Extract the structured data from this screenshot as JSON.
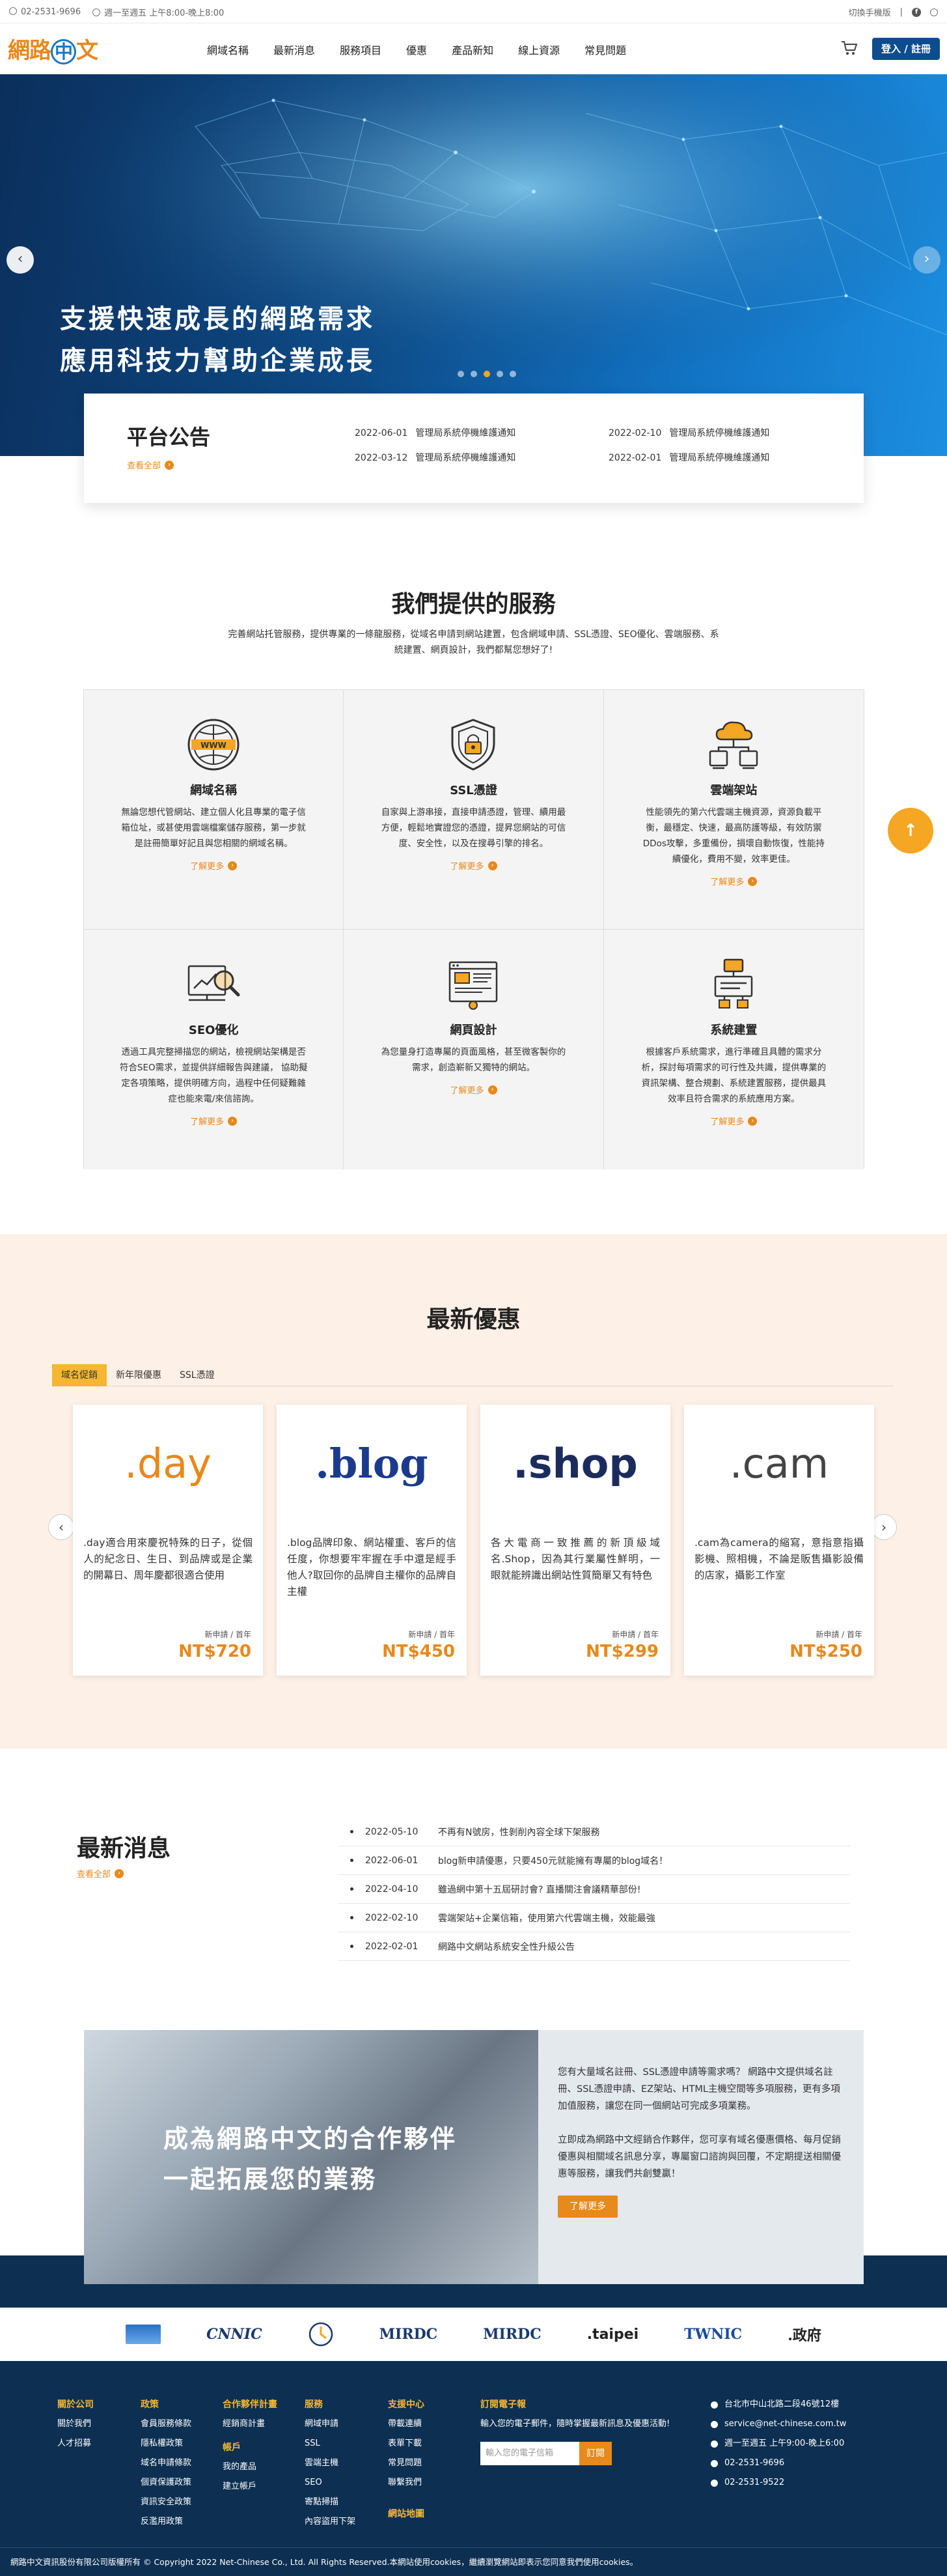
{
  "topbar": {
    "phone": "02-2531-9696",
    "hours": "週一至週五 上午8:00-晚上8:00",
    "mobile": "切換手機版"
  },
  "nav": {
    "logo_a": "網路",
    "logo_b": "中",
    "logo_c": "文",
    "items": [
      "網域名稱",
      "最新消息",
      "服務項目",
      "優惠",
      "產品新知",
      "線上資源",
      "常見問題"
    ],
    "login": "登入 / 註冊"
  },
  "hero": {
    "line1": "支援快速成長的網路需求",
    "line2": "應用科技力幫助企業成長"
  },
  "announce": {
    "title": "平台公告",
    "more": "查看全部",
    "items": [
      {
        "date": "2022-06-01",
        "text": "管理局系統停機維護通知"
      },
      {
        "date": "2022-02-10",
        "text": "管理局系統停機維護通知"
      },
      {
        "date": "2022-03-12",
        "text": "管理局系統停機維護通知"
      },
      {
        "date": "2022-02-01",
        "text": "管理局系統停機維護通知"
      }
    ]
  },
  "services": {
    "title": "我們提供的服務",
    "desc": "完善網站托管服務，提供專業的一條龍服務，從域名申請到網站建置，包含網域申請、SSL憑證、SEO優化、雲端服務、系統建置、網頁設計，我們都幫您想好了!",
    "more": "了解更多",
    "items": [
      {
        "icon": "www-globe-icon",
        "title": "網域名稱",
        "text": "無論您想代管網站、建立個人化且專業的電子信箱位址，或甚使用雲端檔案儲存服務，第一步就是註冊簡單好記且與您相關的網域名稱。"
      },
      {
        "icon": "shield-lock-icon",
        "title": "SSL憑證",
        "text": "自家與上游串接，直接申請憑證，管理、續用最方便，輕鬆地實證您的憑證，提昇您網站的可信度、安全性，以及在搜尋引擎的排名。"
      },
      {
        "icon": "cloud-server-icon",
        "title": "雲端架站",
        "text": "性能領先的第六代雲端主機資源，資源負載平衡，最穩定、快速，最高防護等級，有效防禦DDos攻擊，多重備份，損壞自動恢復，性能持續優化，費用不變，效率更佳。"
      },
      {
        "icon": "seo-magnifier-icon",
        "title": "SEO優化",
        "text": "透過工具完整掃描您的網站，檢視網站架構是否符合SEO需求，並提供詳細報告與建議， 協助擬定各項策略，提供明確方向，過程中任何疑難雜症也能來電/來信諮詢。"
      },
      {
        "icon": "web-design-icon",
        "title": "網頁設計",
        "text": "為您量身打造專屬的頁面風格，甚至微客製你的需求，創造嶄新又獨特的網站。"
      },
      {
        "icon": "system-build-icon",
        "title": "系統建置",
        "text": "根據客戶系統需求，進行準確且具體的需求分析，探討每項需求的可行性及共識，提供專業的資訊架構、整合規劃、系統建置服務，提供最具效率且符合需求的系統應用方案。"
      }
    ]
  },
  "promo": {
    "title": "最新優惠",
    "tabs": [
      "域名促銷",
      "新年限優惠",
      "SSL憑證"
    ],
    "unit": "新申請 / 首年",
    "cards": [
      {
        "tld": ".day",
        "color": "#e8891c",
        "desc": ".day適合用來慶祝特殊的日子，從個人的紀念日、生日、到品牌或是企業的開幕日、周年慶都很適合使用",
        "price": "NT$720"
      },
      {
        "tld": ".blog",
        "color": "#1b3a8c",
        "desc": ".blog品牌印象、網站權重、客戶的信任度，你想要牢牢握在手中還是經手他人?取回你的品牌自主權你的品牌自主權",
        "price": "NT$450"
      },
      {
        "tld": ".shop",
        "color": "#1b2c5c",
        "desc": "各大電商一致推薦的新頂級域名.Shop，因為其行業屬性鮮明，一眼就能辨識出網站性質簡單又有特色",
        "price": "NT$299"
      },
      {
        "tld": ".cam",
        "color": "#444444",
        "desc": ".cam為camera的縮寫，意指意指攝影機、照相機，不論是販售攝影設備的店家，攝影工作室",
        "price": "NT$250"
      }
    ]
  },
  "news": {
    "title": "最新消息",
    "more": "查看全部",
    "items": [
      {
        "date": "2022-05-10",
        "text": "不再有N號房，性剝削內容全球下架服務"
      },
      {
        "date": "2022-06-01",
        "text": "blog新申請優惠，只要450元就能擁有專屬的blog域名！"
      },
      {
        "date": "2022-04-10",
        "text": "雖過網中第十五屆研討會? 直播關注會議精華部份!"
      },
      {
        "date": "2022-02-10",
        "text": "雲端架站+企業信箱，使用第六代雲端主機，效能最強"
      },
      {
        "date": "2022-02-01",
        "text": "網路中文網站系統安全性升級公告"
      }
    ]
  },
  "partner": {
    "line1": "成為網路中文的合作夥伴",
    "line2": "一起拓展您的業務",
    "p1": "您有大量域名註冊、SSL憑證申請等需求嗎？ 網路中文提供域名註冊、SSL憑證申請、EZ架站、HTML主機空間等多項服務，更有多項加值服務，讓您在同一個網站可完成多項業務。",
    "p2": "立即成為網路中文經銷合作夥伴，您可享有域名優惠價格、每月促銷優惠與相關域名訊息分享，專屬窗口諮詢與回覆，不定期提送相關優惠等服務，讓我們共創雙贏！",
    "btn": "了解更多"
  },
  "logos": [
    "TWNIC",
    "CNNIC",
    "MIRDC",
    "MIRDC",
    "MIRDC",
    ".taipei",
    "TWNIC",
    ".政府"
  ],
  "footer": {
    "col1": {
      "title": "關於公司",
      "links": [
        "關於我們",
        "人才招募"
      ]
    },
    "col2": {
      "title": "政策",
      "links": [
        "會員服務條款",
        "隱私權政策",
        "域名申請條款",
        "個資保護政策",
        "資訊安全政策",
        "反濫用政策"
      ]
    },
    "col3": {
      "title": "合作夥伴計畫",
      "links": [
        "經銷商計畫"
      ],
      "title2": "帳戶",
      "links2": [
        "我的產品",
        "建立帳戶"
      ]
    },
    "col4": {
      "title": "服務",
      "links": [
        "網域申請",
        "SSL",
        "雲端主機",
        "SEO",
        "寄點掃描",
        "內容盜用下架"
      ]
    },
    "col5": {
      "title": "支援中心",
      "links": [
        "帶載連續",
        "表單下載",
        "常見問題",
        "聯繫我們"
      ],
      "title2": "網站地圖"
    },
    "sub": {
      "title": "訂閱電子報",
      "desc": "輸入您的電子郵件，隨時掌握最新訊息及優惠活動!",
      "placeholder": "輸入您的電子信箱",
      "btn": "訂閱"
    },
    "contact": [
      "台北市中山北路二段46號12樓",
      "service@net-chinese.com.tw",
      "週一至週五 上午9:00-晚上6:00",
      "02-2531-9696",
      "02-2531-9522"
    ]
  },
  "copyright": "網路中文資訊股份有限公司版權所有 © Copyright 2022 Net-Chinese Co., Ltd. All Rights Reserved.本網站使用cookies，繼續瀏覽網站即表示您同意我們使用cookies。"
}
